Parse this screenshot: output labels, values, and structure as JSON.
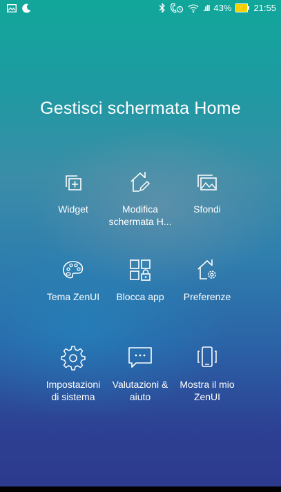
{
  "status_bar": {
    "icons_left": [
      "image-icon",
      "moon-icon"
    ],
    "icons_right": [
      "bluetooth-icon",
      "alarm-call-icon",
      "wifi-icon",
      "signal-icon"
    ],
    "signal_label": ".ıll",
    "battery_percent": "43%",
    "time": "21:55"
  },
  "title": "Gestisci schermata Home",
  "tiles": [
    {
      "label": "Widget",
      "icon": "widget-icon"
    },
    {
      "label": "Modifica\nschermata H...",
      "icon": "edit-home-icon"
    },
    {
      "label": "Sfondi",
      "icon": "wallpaper-icon"
    },
    {
      "label": "Tema ZenUI",
      "icon": "palette-icon"
    },
    {
      "label": "Blocca app",
      "icon": "lock-apps-icon"
    },
    {
      "label": "Preferenze",
      "icon": "home-settings-icon"
    },
    {
      "label": "Impostazioni\ndi sistema",
      "icon": "gear-icon"
    },
    {
      "label": "Valutazioni &\naiuto",
      "icon": "chat-bubble-icon"
    },
    {
      "label": "Mostra il mio\nZenUI",
      "icon": "phone-share-icon"
    }
  ],
  "colors": {
    "top": "#11a79a",
    "bottom": "#2d3a8d",
    "battery": "#f5d000"
  }
}
